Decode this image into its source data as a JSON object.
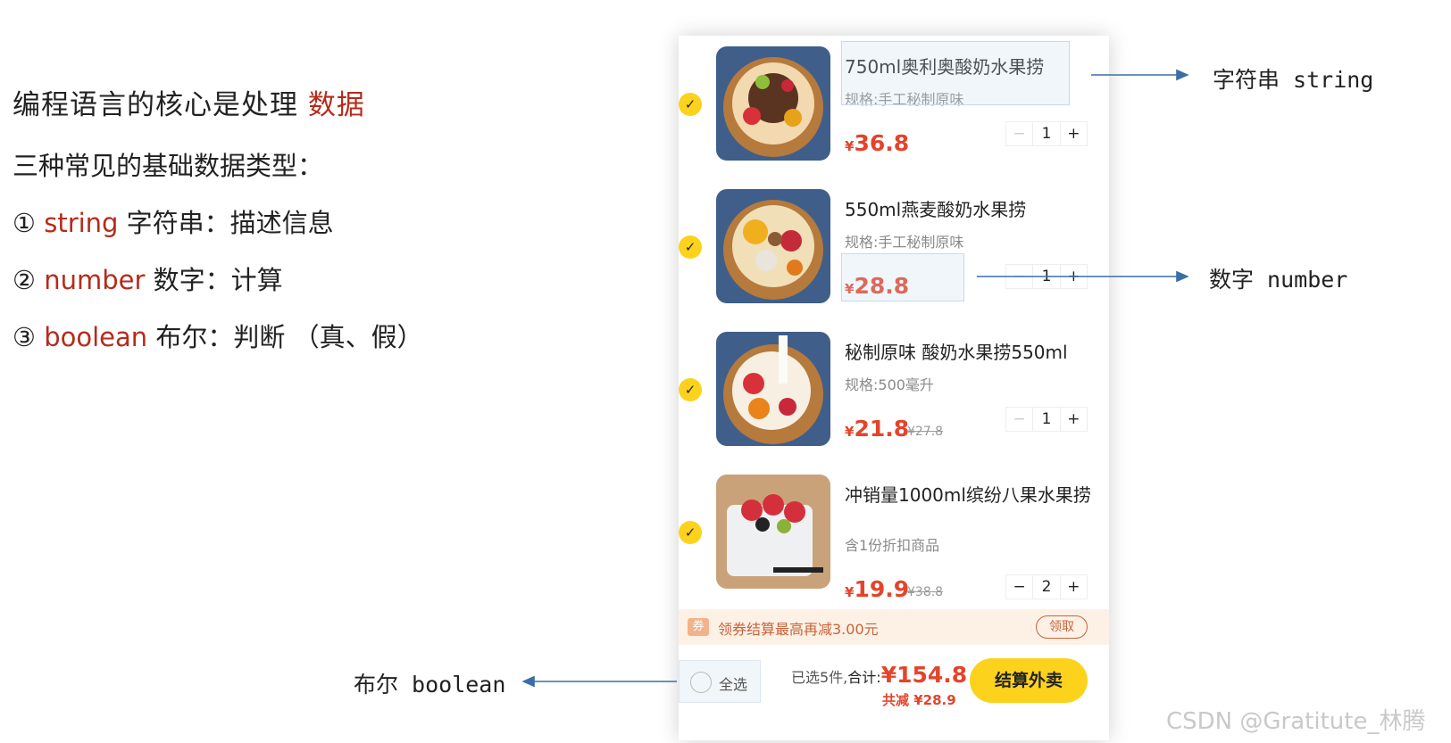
{
  "intro": {
    "headline_prefix": "编程语言的核心是处理 ",
    "headline_highlight": "数据",
    "subheading": "三种常见的基础数据类型：",
    "types": [
      {
        "num": "①",
        "kw": "string",
        "desc": " 字符串：描述信息"
      },
      {
        "num": "②",
        "kw": "number",
        "desc": " 数字：计算"
      },
      {
        "num": "③",
        "kw": "boolean",
        "desc": " 布尔：判断 （真、假）"
      }
    ]
  },
  "cart": {
    "items": [
      {
        "title": "750ml奥利奥酸奶水果捞",
        "spec": "规格:手工秘制原味",
        "currency": "¥",
        "price": "36.8",
        "old_price": "",
        "qty": "1",
        "check": "✓"
      },
      {
        "title": "550ml燕麦酸奶水果捞",
        "spec": "规格:手工秘制原味",
        "currency": "¥",
        "price": "28.8",
        "old_price": "",
        "qty": "1",
        "check": "✓"
      },
      {
        "title": "秘制原味 酸奶水果捞550ml",
        "spec": "规格:500毫升",
        "currency": "¥",
        "price": "21.8",
        "old_price": "¥27.8",
        "qty": "1",
        "check": "✓"
      },
      {
        "title": "冲销量1000ml缤纷八果水果捞",
        "spec": "含1份折扣商品",
        "currency": "¥",
        "price": "19.9",
        "old_price": "¥38.8",
        "qty": "2",
        "check": "✓"
      }
    ],
    "stepper": {
      "minus": "−",
      "plus": "+"
    },
    "coupon": {
      "icon": "券",
      "text": "领券结算最高再减3.00元",
      "button": "领取"
    },
    "footer": {
      "select_all": "全选",
      "selected_count": "已选5件,",
      "total_label": "合计:",
      "total": "¥154.8",
      "saved": "共减 ¥28.9",
      "checkout": "结算外卖"
    }
  },
  "annotations": {
    "string_label": "字符串 string",
    "number_label": "数字 number",
    "boolean_label": "布尔 boolean"
  },
  "watermark": "CSDN @Gratitute_林腾",
  "colors": {
    "accent_red": "#e3442b",
    "brand_yellow": "#fcd21d",
    "keyword_red": "#b52b1b",
    "annotation_blue": "#3a6ea5"
  }
}
